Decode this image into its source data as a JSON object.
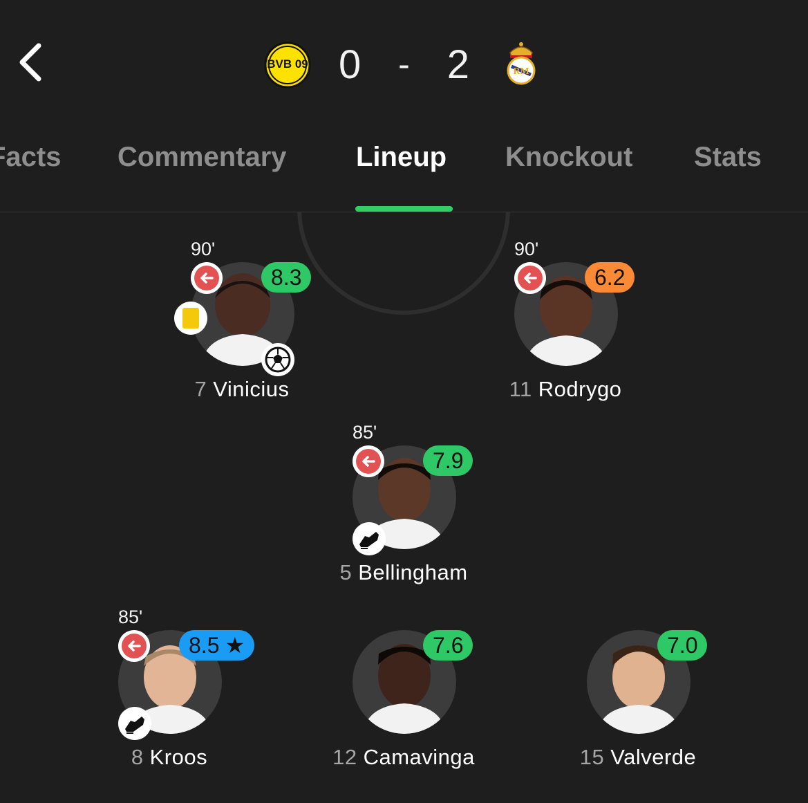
{
  "header": {
    "home_crest": "BVB 09",
    "home_score": "0",
    "separator": "-",
    "away_score": "2"
  },
  "tabs": [
    {
      "label": "Facts"
    },
    {
      "label": "Commentary"
    },
    {
      "label": "Lineup",
      "active": true
    },
    {
      "label": "Knockout"
    },
    {
      "label": "Stats"
    }
  ],
  "colors": {
    "background": "#1e1e1e",
    "accent": "#2fd061",
    "rating_green": "#2fc866",
    "rating_orange": "#fb8a37",
    "rating_blue": "#1a9cf5",
    "sub_red": "#e25252",
    "yellow_card": "#f4c90c"
  },
  "players": [
    {
      "id": "vinicius",
      "number": "7",
      "name": "Vinicius",
      "rating": "8.3",
      "rating_color": "#2fc866",
      "sub_minute": "90'",
      "yellow_card": true,
      "event": "ball-icon",
      "star": false
    },
    {
      "id": "rodrygo",
      "number": "11",
      "name": "Rodrygo",
      "rating": "6.2",
      "rating_color": "#fb8a37",
      "sub_minute": "90'",
      "yellow_card": false,
      "event": null,
      "star": false
    },
    {
      "id": "bellingham",
      "number": "5",
      "name": "Bellingham",
      "rating": "7.9",
      "rating_color": "#2fc866",
      "sub_minute": "85'",
      "yellow_card": false,
      "event": "boot-icon",
      "star": false
    },
    {
      "id": "kroos",
      "number": "8",
      "name": "Kroos",
      "rating": "8.5",
      "rating_color": "#1a9cf5",
      "sub_minute": "85'",
      "yellow_card": false,
      "event": "boot-icon",
      "star": true
    },
    {
      "id": "camavinga",
      "number": "12",
      "name": "Camavinga",
      "rating": "7.6",
      "rating_color": "#2fc866",
      "sub_minute": null,
      "yellow_card": false,
      "event": null,
      "star": false
    },
    {
      "id": "valverde",
      "number": "15",
      "name": "Valverde",
      "rating": "7.0",
      "rating_color": "#2fc866",
      "sub_minute": null,
      "yellow_card": false,
      "event": null,
      "star": false
    }
  ]
}
